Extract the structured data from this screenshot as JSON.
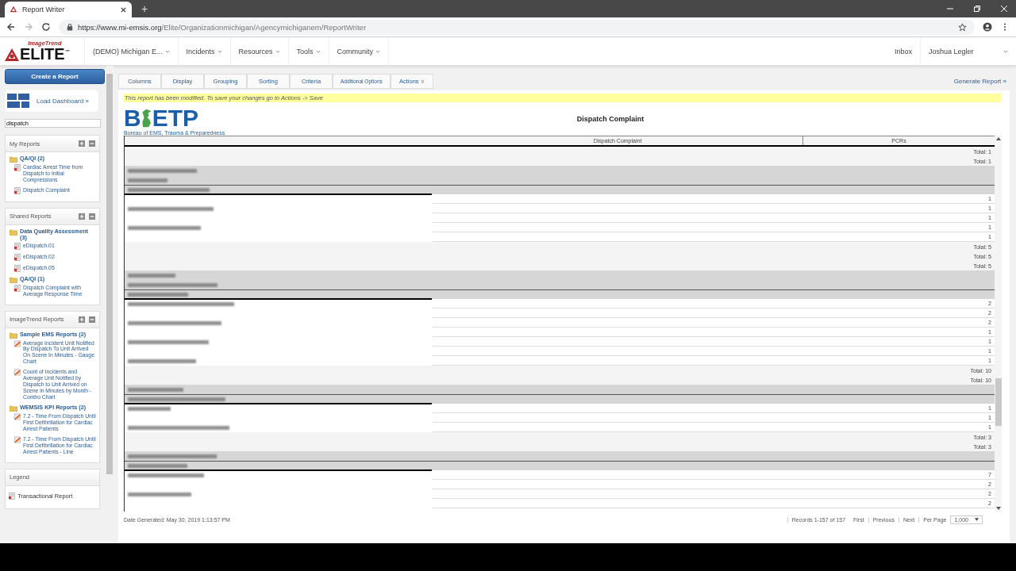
{
  "browser": {
    "tab_title": "Report Writer",
    "new_tab": "+",
    "url_host": "https://www.mi-emsis.org",
    "url_path": "/Elite/Organizationmichigan/Agencymichiganem/ReportWriter"
  },
  "brand": {
    "maker": "ImageTrend",
    "name": "ELITE",
    "mark": "™"
  },
  "nav": [
    {
      "label": "(DEMO) Michigan E..."
    },
    {
      "label": "Incidents"
    },
    {
      "label": "Resources"
    },
    {
      "label": "Tools"
    },
    {
      "label": "Community"
    }
  ],
  "user_nav": {
    "inbox": "Inbox",
    "user": "Joshua Legler"
  },
  "sidebar": {
    "create_button": "Create a Report",
    "load_dashboard": "Load Dashboard »",
    "search": {
      "value": "dispatch"
    },
    "panels": [
      {
        "title": "My Reports",
        "folders": [
          {
            "name": "QA/QI (2)",
            "reports": [
              {
                "name": "Cardiac Arrest Time from Dispatch to Initial Compressions",
                "kind": "table"
              },
              {
                "name": "Dispatch Complaint",
                "kind": "table"
              }
            ]
          }
        ]
      },
      {
        "title": "Shared Reports",
        "folders": [
          {
            "name": "Data Quality Assessment (3)",
            "reports": [
              {
                "name": "eDispatch.01",
                "kind": "table"
              },
              {
                "name": "eDispatch.02",
                "kind": "table"
              },
              {
                "name": "eDispatch.05",
                "kind": "table"
              }
            ]
          },
          {
            "name": "QA/QI (1)",
            "reports": [
              {
                "name": "Dispatch Complaint with Average Response Time",
                "kind": "table"
              }
            ]
          }
        ]
      },
      {
        "title": "ImageTrend Reports",
        "folders": [
          {
            "name": "Sample EMS Reports (2)",
            "reports": [
              {
                "name": "Average Incident Unit Notified By Dispatch To Unit Arrived On Scene In Minutes - Gauge Chart",
                "kind": "chart"
              },
              {
                "name": "Count of Incidents and Average Unit Notified by Dispatch to Unit Arrived on Scene in Minutes by Month - Combo Chart",
                "kind": "chart"
              }
            ]
          },
          {
            "name": "WEMSIS KPI Reports (2)",
            "reports": [
              {
                "name": "7.2 - Time From Dispatch Until First Defibrillation for Cardiac Arrest Patients",
                "kind": "chart"
              },
              {
                "name": "7.2 - Time From Dispatch Until First Defibrillation for Cardiac Arrest Patients - Line",
                "kind": "chart"
              }
            ]
          }
        ]
      }
    ],
    "legend": {
      "title": "Legend",
      "items": [
        {
          "label": "Transactional Report"
        }
      ]
    }
  },
  "tabs": [
    {
      "label": "Columns"
    },
    {
      "label": "Display"
    },
    {
      "label": "Grouping"
    },
    {
      "label": "Sorting"
    },
    {
      "label": "Criteria"
    },
    {
      "label": "Additional Options",
      "kind": "small"
    },
    {
      "label": "Actions",
      "kind": "menu"
    }
  ],
  "generate": "Generate Report »",
  "notice": "This report has been modified. To save your changes go to Actions -> Save",
  "logo": {
    "lead": "B",
    "rest": "ETP",
    "tagline": "Bureau of EMS, Trauma & Preparedness"
  },
  "report_title": "Dispatch Complaint",
  "table": {
    "columns": [
      "Dispatch Complaint",
      "PCRs"
    ],
    "rows": [
      {
        "kind": "total",
        "value": "Total: 1"
      },
      {
        "kind": "total",
        "value": "Total: 1"
      },
      {
        "kind": "group",
        "tall": true
      },
      {
        "kind": "data",
        "value": "1"
      },
      {
        "kind": "data",
        "value": "1"
      },
      {
        "kind": "data",
        "value": "1"
      },
      {
        "kind": "data",
        "value": "1"
      },
      {
        "kind": "data",
        "value": "1"
      },
      {
        "kind": "total",
        "value": "Total: 5"
      },
      {
        "kind": "total",
        "value": "Total: 5"
      },
      {
        "kind": "total",
        "value": "Total: 5"
      },
      {
        "kind": "group",
        "tall": true
      },
      {
        "kind": "data",
        "value": "2"
      },
      {
        "kind": "data",
        "value": "2"
      },
      {
        "kind": "data",
        "value": "2"
      },
      {
        "kind": "data",
        "value": "1"
      },
      {
        "kind": "data",
        "value": "1"
      },
      {
        "kind": "data",
        "value": "1"
      },
      {
        "kind": "data",
        "value": "1"
      },
      {
        "kind": "total",
        "value": "Total: 10"
      },
      {
        "kind": "total",
        "value": "Total: 10"
      },
      {
        "kind": "group",
        "tall": false
      },
      {
        "kind": "data",
        "value": "1"
      },
      {
        "kind": "data",
        "value": "1"
      },
      {
        "kind": "data",
        "value": "1"
      },
      {
        "kind": "total",
        "value": "Total: 3"
      },
      {
        "kind": "total",
        "value": "Total: 3"
      },
      {
        "kind": "group",
        "tall": false
      },
      {
        "kind": "data",
        "value": "7"
      },
      {
        "kind": "data",
        "value": "2"
      },
      {
        "kind": "data",
        "value": "2"
      },
      {
        "kind": "data",
        "value": "2"
      }
    ]
  },
  "footer": {
    "generated": "Date Generated: May 30, 2019 1:13:57 PM",
    "records": "Records 1-157 of 157",
    "pages": [
      "First",
      "Previous",
      "Next"
    ],
    "per_page_label": "Per Page",
    "per_page": "1,000"
  }
}
